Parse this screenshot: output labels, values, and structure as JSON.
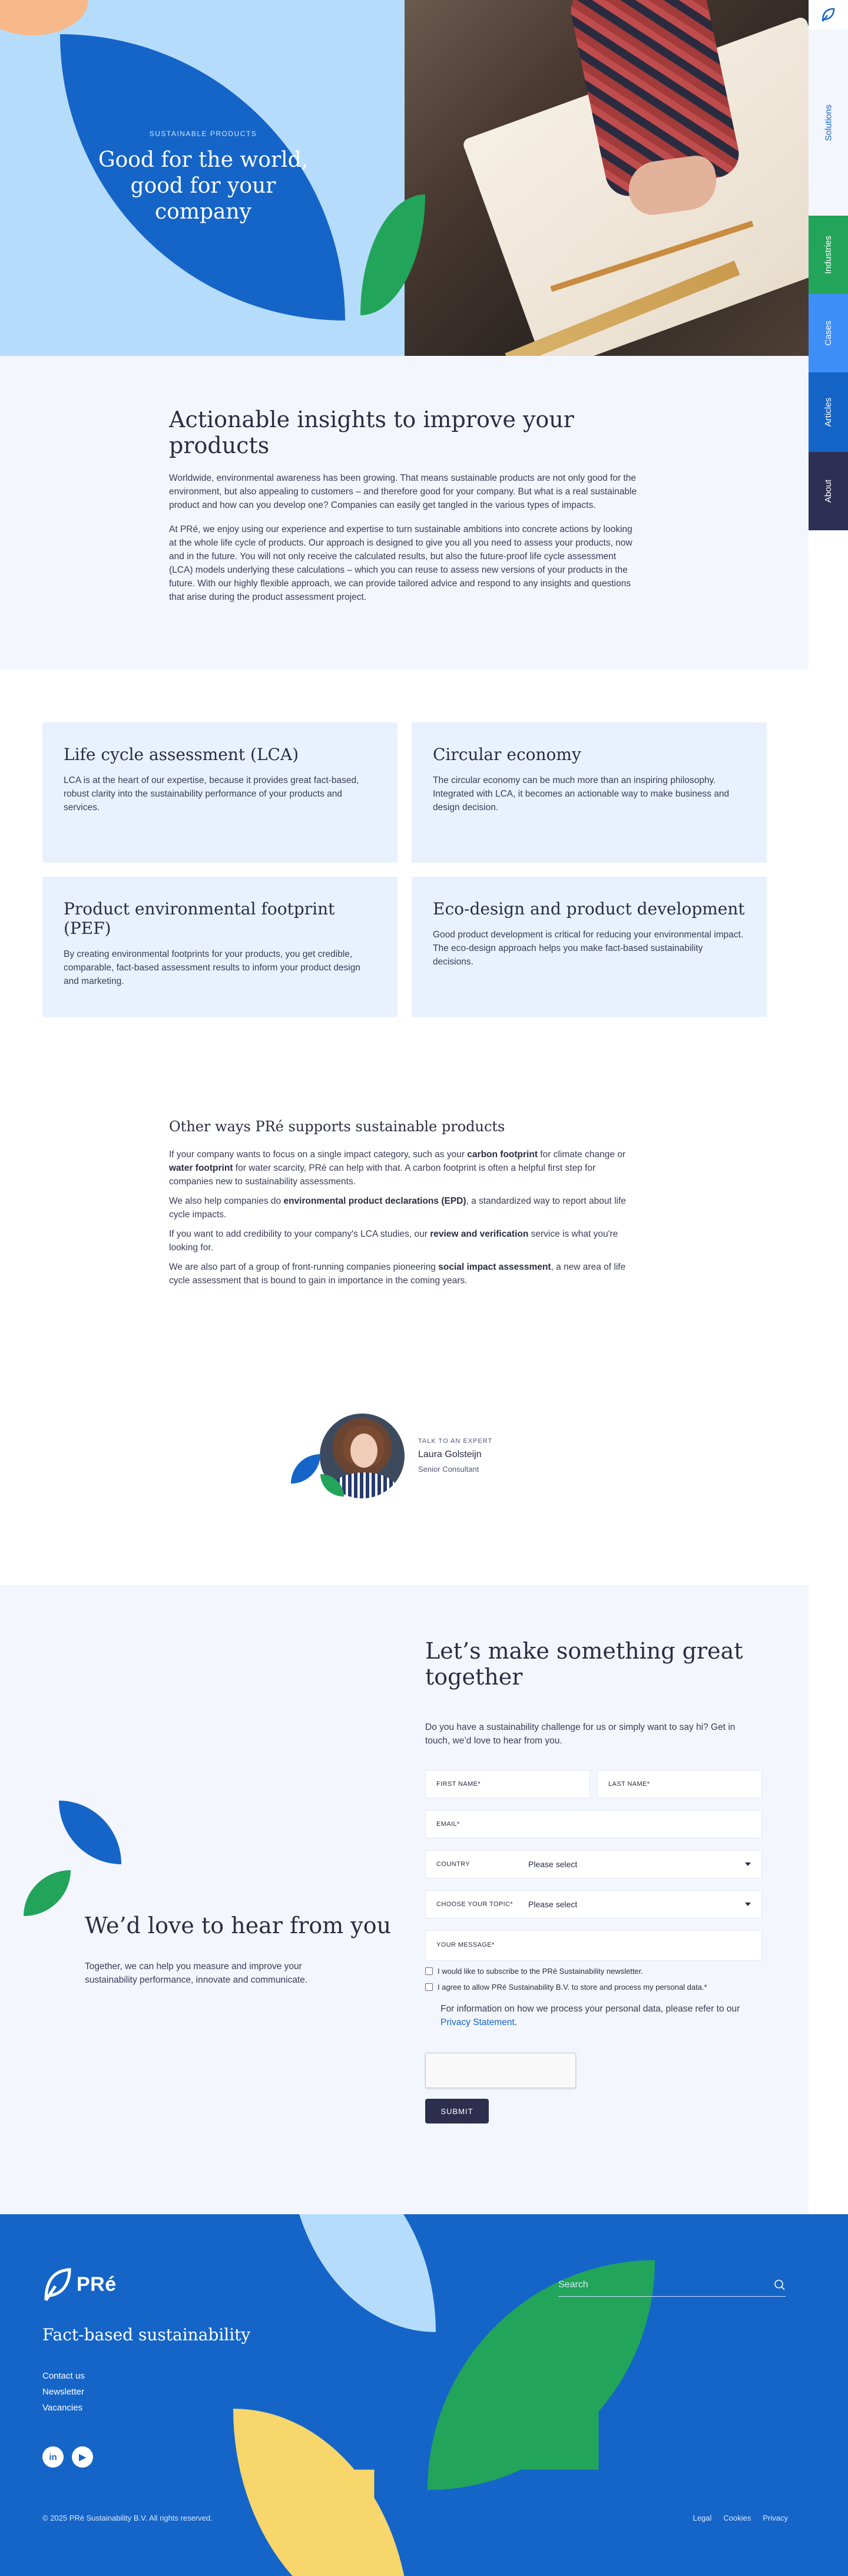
{
  "hero": {
    "eyebrow": "SUSTAINABLE PRODUCTS",
    "title": "Good for the world, good for your company"
  },
  "side_nav": {
    "tabs": [
      {
        "label": "Solutions",
        "color": "#1565c8"
      },
      {
        "label": "Industries",
        "color": "#22a55a"
      },
      {
        "label": "Cases",
        "color": "#3e8ef7"
      },
      {
        "label": "Articles",
        "color": "#1565c8"
      },
      {
        "label": "About",
        "color": "#2e2f55"
      }
    ]
  },
  "intro": {
    "title": "Actionable insights to improve your products",
    "p1": "Worldwide, environmental awareness has been growing. That means sustainable products are not only good for the environment, but also appealing to customers – and therefore good for your company. But what is a real sustainable product and how can you develop one? Companies can easily get tangled in the various types of impacts.",
    "p2": "At PRé, we enjoy using our experience and expertise to turn sustainable ambitions into concrete actions by looking at the whole life cycle of products. Our approach is designed to give you all you need to assess your products, now and in the future. You will not only receive the calculated results, but also the future-proof life cycle assessment (LCA) models underlying these calculations – which you can reuse to assess new versions of your products in the future. With our highly flexible approach, we can provide tailored advice and respond to any insights and questions that arise during the product assessment project."
  },
  "cards": [
    {
      "title": "Life cycle assessment (LCA)",
      "text": "LCA is at the heart of our expertise, because it provides great fact-based, robust clarity into the sustainability performance of your products and services."
    },
    {
      "title": "Circular economy",
      "text": "The circular economy can be much more than an inspiring philosophy. Integrated with LCA, it becomes an actionable way to make business and design decision."
    },
    {
      "title": "Product environmental footprint (PEF)",
      "text": "By creating environmental footprints for your products, you get credible, comparable, fact-based assessment results to inform your product design and marketing."
    },
    {
      "title": "Eco-design and product development",
      "text": "Good product development is critical for reducing your environmental impact. The eco-design approach helps you make fact-based sustainability decisions."
    }
  ],
  "other": {
    "title": "Other ways PRé supports sustainable products",
    "p1a": "If your company wants to focus on a single impact category, such as your ",
    "p1b": "carbon footprint",
    "p1c": " for climate change or ",
    "p1d": "water footprint",
    "p1e": " for water scarcity, PRé can help with that. A carbon footprint is often a helpful first step for companies new to sustainability assessments.",
    "p2a": "We also help companies do ",
    "p2b": "environmental product declarations (EPD)",
    "p2c": ", a standardized way to report about life cycle impacts.",
    "p3a": "If you want to add credibility to your company's LCA studies, our ",
    "p3b": "review and verification",
    "p3c": " service is what you're looking for.",
    "p4a": "We are also part of a group of front-running companies pioneering ",
    "p4b": "social impact assessment",
    "p4c": ", a new area of life cycle assessment that is bound to gain in importance in the coming years."
  },
  "expert": {
    "eyebrow": "TALK TO AN EXPERT",
    "name": "Laura Golsteijn",
    "role": "Senior Consultant"
  },
  "contact": {
    "left_title": "We’d love to hear from you",
    "left_text": "Together, we can help you measure and improve your sustainability performance, innovate and communicate.",
    "title": "Let’s make something great together",
    "lead": "Do you have a sustainability challenge for us or simply want to say hi? Get in touch, we’d love to hear from you.",
    "first_name": "FIRST NAME*",
    "last_name": "LAST NAME*",
    "email": "EMAIL*",
    "country_label": "COUNTRY",
    "country_value": "Please select",
    "topic_label": "CHOOSE YOUR TOPIC*",
    "topic_value": "Please select",
    "message": "YOUR MESSAGE*",
    "newsletter": "I would like to subscribe to the PRé Sustainability newsletter.",
    "consent": "I agree to allow PRé Sustainability B.V. to store and process my personal data.*",
    "privacy_text": "For information on how we process your personal data, please refer to our ",
    "privacy_link": "Privacy Statement",
    "privacy_end": ".",
    "submit": "SUBMIT"
  },
  "footer": {
    "logo": "PRé",
    "tagline": "Fact-based sustainability",
    "links": [
      "Contact us",
      "Newsletter",
      "Vacancies"
    ],
    "social": [
      {
        "icon": "linkedin-icon",
        "glyph": "in"
      },
      {
        "icon": "youtube-icon",
        "glyph": "▶"
      }
    ],
    "search_placeholder": "Search",
    "copyright": "© 2025 PRé Sustainability B.V. All rights reserved.",
    "legal": [
      "Legal",
      "Cookies",
      "Privacy"
    ]
  }
}
